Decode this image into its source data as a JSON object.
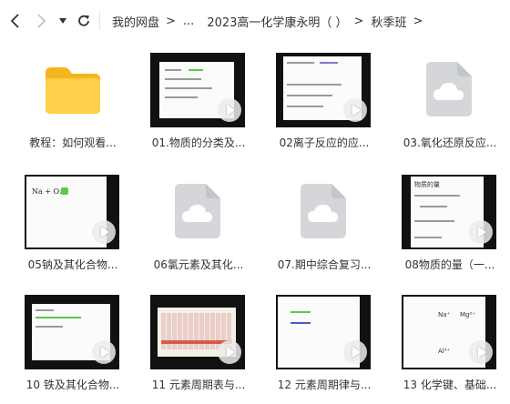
{
  "nav": {
    "back_icon": "chevron-left-icon",
    "forward_icon": "chevron-right-icon",
    "dropdown_icon": "caret-down-icon",
    "refresh_icon": "refresh-icon"
  },
  "breadcrumb": {
    "root": "我的网盘",
    "ellipsis": "...",
    "parent": "2023高一化学康永明（ ）",
    "current": "秋季班",
    "separator": ">"
  },
  "files": [
    {
      "name": "教程：如何观看...",
      "kind": "folder"
    },
    {
      "name": "01.物质的分类及...",
      "kind": "video"
    },
    {
      "name": "02离子反应的应...",
      "kind": "video"
    },
    {
      "name": "03.氧化还原反应...",
      "kind": "cloud-file"
    },
    {
      "name": "05钠及其化合物...",
      "kind": "video"
    },
    {
      "name": "06氯元素及其化...",
      "kind": "cloud-file"
    },
    {
      "name": "07.期中综合复习...",
      "kind": "cloud-file"
    },
    {
      "name": "08物质的量（一...",
      "kind": "video"
    },
    {
      "name": "10 铁及其化合物...",
      "kind": "video"
    },
    {
      "name": "11 元素周期表与...",
      "kind": "video"
    },
    {
      "name": "12 元素周期律与...",
      "kind": "video"
    },
    {
      "name": "13 化学键、基础...",
      "kind": "video"
    }
  ],
  "thumb_text": {
    "t5": "Na + O₂",
    "t8_title": "物质的量",
    "t12_a": "Na⁺",
    "t12_b": "Mg²⁺",
    "t12_c": "Al³⁺"
  },
  "colors": {
    "folder": "#f7c02e",
    "cloud_bg": "#d4d6da",
    "highlight_green": "#5cc94a"
  }
}
